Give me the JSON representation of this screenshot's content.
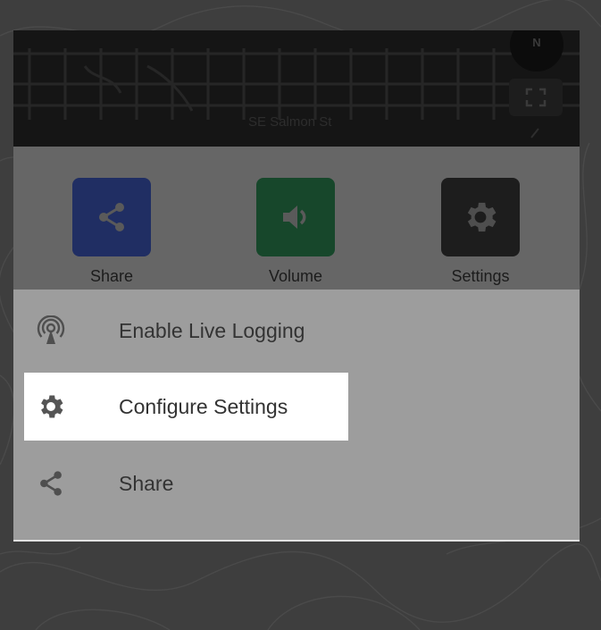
{
  "map": {
    "street_label": "SE Salmon St",
    "compass_label": "N"
  },
  "actions": [
    {
      "label": "Share",
      "icon": "share-icon",
      "color": "#202e63"
    },
    {
      "label": "Volume",
      "icon": "volume-icon",
      "color": "#17472b"
    },
    {
      "label": "Settings",
      "icon": "gear-icon",
      "color": "#1d1d1d"
    }
  ],
  "menu": {
    "items": [
      {
        "label": "Enable Live Logging",
        "icon": "live-broadcast-icon",
        "focused": false
      },
      {
        "label": "Configure Settings",
        "icon": "gear-icon",
        "focused": true
      },
      {
        "label": "Share",
        "icon": "share-icon",
        "focused": false
      }
    ]
  },
  "colors": {
    "overlay_dim": "#666666",
    "sheet": "#9d9d9d",
    "focus_highlight": "#ffffff",
    "text": "#333333"
  }
}
